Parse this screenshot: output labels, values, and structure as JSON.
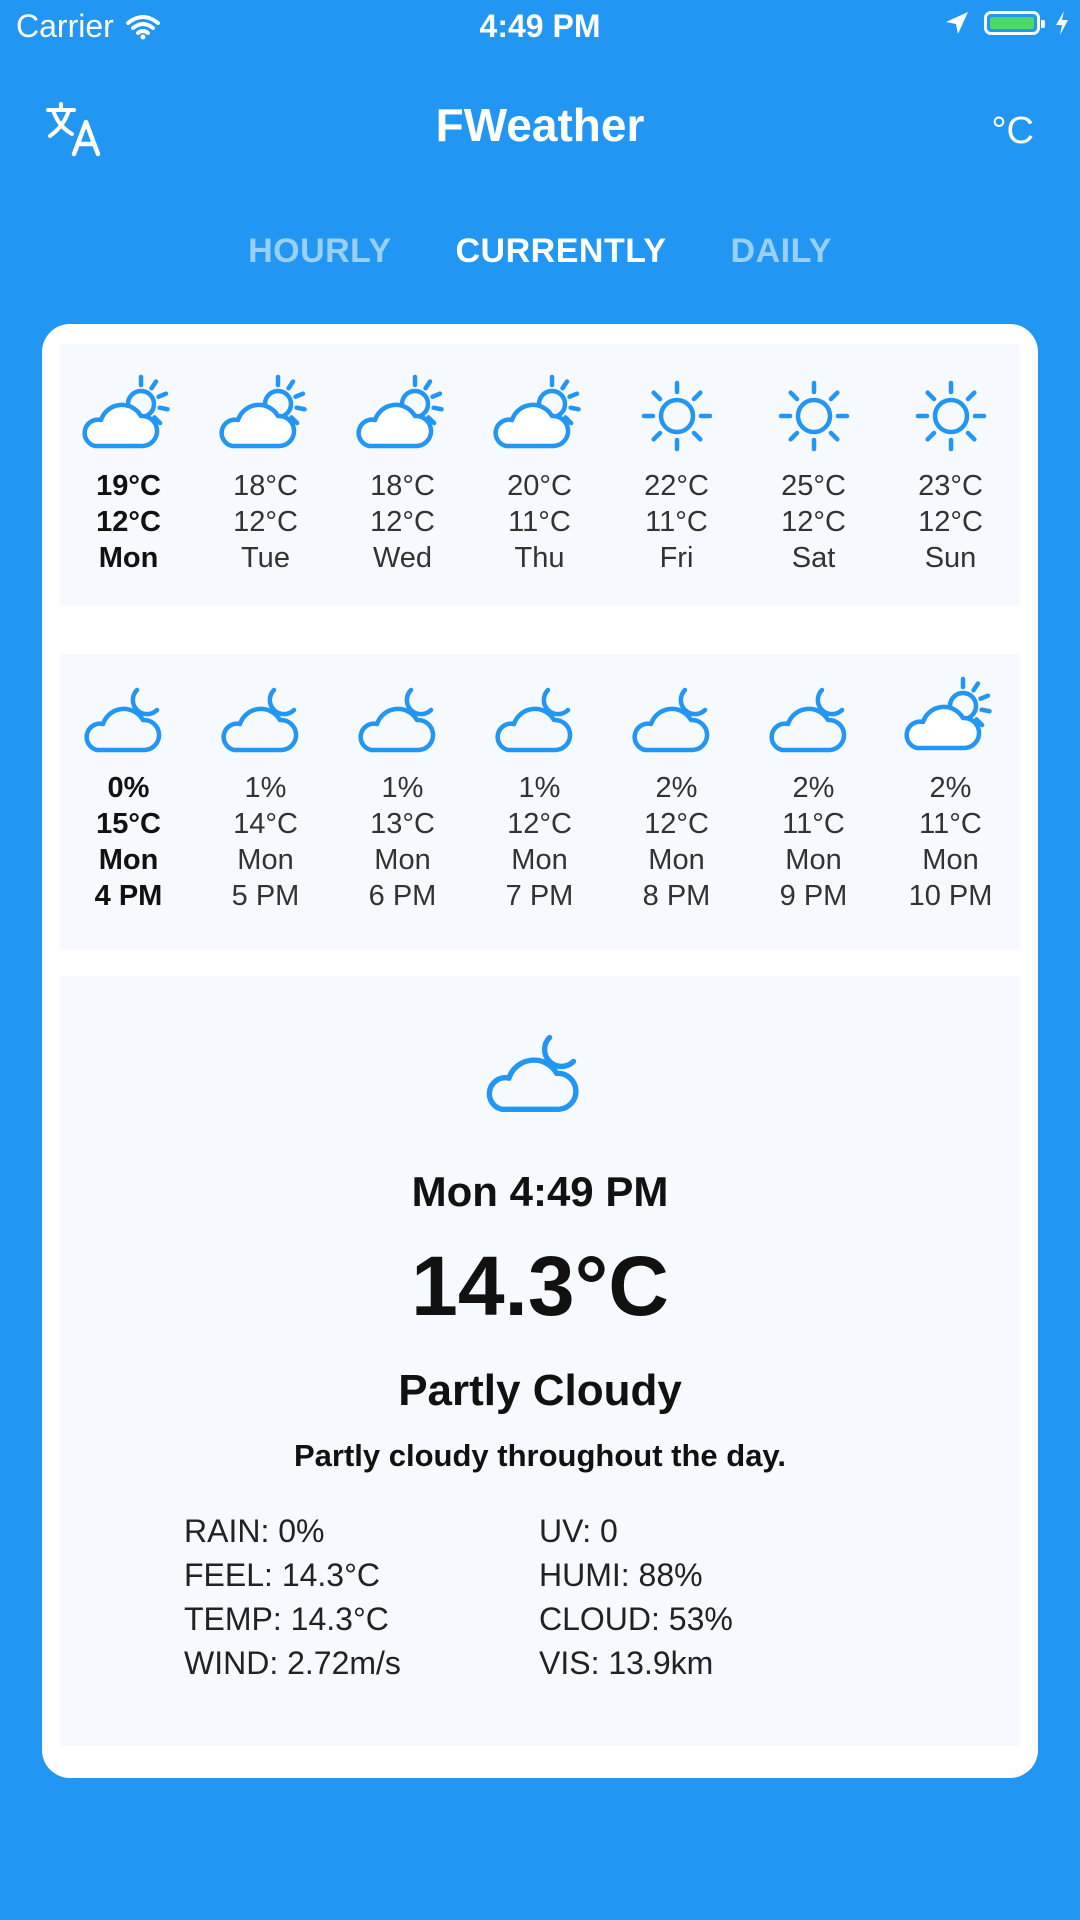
{
  "status_bar": {
    "carrier": "Carrier",
    "time": "4:49 PM",
    "battery_level": 1.0
  },
  "header": {
    "title": "FWeather",
    "unit": "°C",
    "translate_icon": "translate-icon"
  },
  "tabs": [
    {
      "label": "HOURLY",
      "active": false
    },
    {
      "label": "CURRENTLY",
      "active": true
    },
    {
      "label": "DAILY",
      "active": false
    }
  ],
  "daily": [
    {
      "high": "19°C",
      "low": "12°C",
      "day": "Mon",
      "icon": "partly-cloudy-day-icon",
      "bold": true
    },
    {
      "high": "18°C",
      "low": "12°C",
      "day": "Tue",
      "icon": "partly-cloudy-day-icon",
      "bold": false
    },
    {
      "high": "18°C",
      "low": "12°C",
      "day": "Wed",
      "icon": "partly-cloudy-day-icon",
      "bold": false
    },
    {
      "high": "20°C",
      "low": "11°C",
      "day": "Thu",
      "icon": "partly-cloudy-day-icon",
      "bold": false
    },
    {
      "high": "22°C",
      "low": "11°C",
      "day": "Fri",
      "icon": "sun-icon",
      "bold": false
    },
    {
      "high": "25°C",
      "low": "12°C",
      "day": "Sat",
      "icon": "sun-icon",
      "bold": false
    },
    {
      "high": "23°C",
      "low": "12°C",
      "day": "Sun",
      "icon": "sun-icon",
      "bold": false
    }
  ],
  "hourly": [
    {
      "rain": "0%",
      "temp": "15°C",
      "day": "Mon",
      "time": "4 PM",
      "icon": "partly-cloudy-night-icon",
      "bold": true
    },
    {
      "rain": "1%",
      "temp": "14°C",
      "day": "Mon",
      "time": "5 PM",
      "icon": "partly-cloudy-night-icon",
      "bold": false
    },
    {
      "rain": "1%",
      "temp": "13°C",
      "day": "Mon",
      "time": "6 PM",
      "icon": "partly-cloudy-night-icon",
      "bold": false
    },
    {
      "rain": "1%",
      "temp": "12°C",
      "day": "Mon",
      "time": "7 PM",
      "icon": "partly-cloudy-night-icon",
      "bold": false
    },
    {
      "rain": "2%",
      "temp": "12°C",
      "day": "Mon",
      "time": "8 PM",
      "icon": "partly-cloudy-night-icon",
      "bold": false
    },
    {
      "rain": "2%",
      "temp": "11°C",
      "day": "Mon",
      "time": "9 PM",
      "icon": "partly-cloudy-night-icon",
      "bold": false
    },
    {
      "rain": "2%",
      "temp": "11°C",
      "day": "Mon",
      "time": "10 PM",
      "icon": "partly-cloudy-day-icon",
      "bold": false
    }
  ],
  "current": {
    "icon": "partly-cloudy-night-icon",
    "datetime": "Mon 4:49 PM",
    "temperature": "14.3°C",
    "condition": "Partly Cloudy",
    "summary": "Partly cloudy throughout the day.",
    "details": [
      "RAIN: 0%",
      "UV: 0",
      "FEEL: 14.3°C",
      "HUMI: 88%",
      "TEMP: 14.3°C",
      "CLOUD: 53%",
      "WIND: 2.72m/s",
      "VIS: 13.9km"
    ]
  },
  "colors": {
    "background": "#2196f3",
    "icon": "#2196f3",
    "text": "#111111"
  }
}
